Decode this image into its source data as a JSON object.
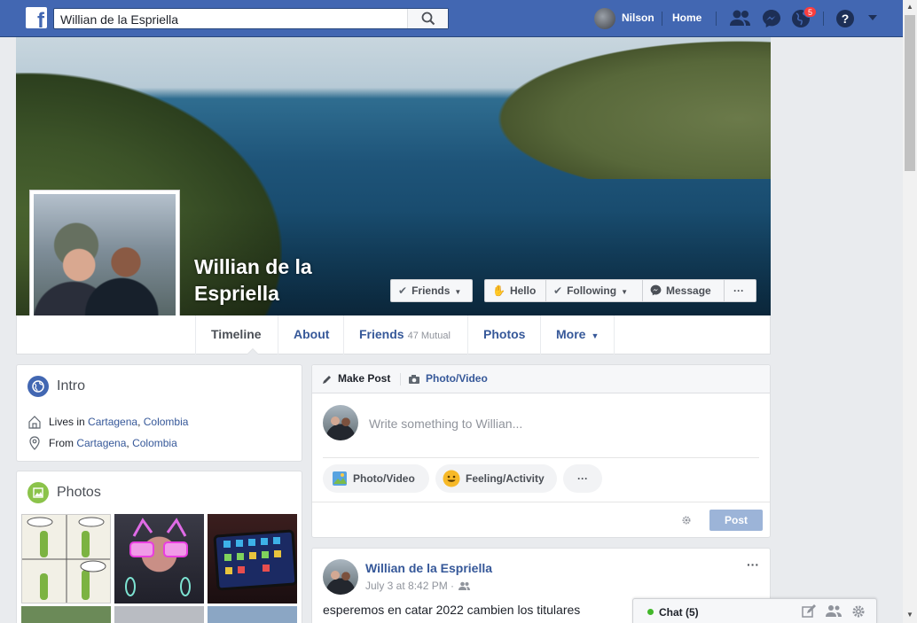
{
  "topbar": {
    "logo": "f",
    "search_value": "Willian de la Espriella",
    "user_name": "Nilson",
    "home_label": "Home",
    "notification_count": "5"
  },
  "profile": {
    "name": "Willian de la Espriella",
    "buttons": {
      "friends": "Friends",
      "hello": "Hello",
      "following": "Following",
      "message": "Message",
      "more": "···"
    }
  },
  "profile_nav": {
    "timeline": "Timeline",
    "about": "About",
    "friends": "Friends",
    "mutual": "47 Mutual",
    "photos": "Photos",
    "more": "More"
  },
  "intro": {
    "title": "Intro",
    "lives_prefix": "Lives in",
    "lives_city": "Cartagena",
    "lives_country": "Colombia",
    "from_prefix": "From",
    "from_city": "Cartagena",
    "from_country": "Colombia"
  },
  "photos": {
    "title": "Photos"
  },
  "composer": {
    "make_post": "Make Post",
    "photo_video_tab": "Photo/Video",
    "placeholder": "Write something to Willian...",
    "photo_video": "Photo/Video",
    "feeling": "Feeling/Activity",
    "more": "···",
    "post": "Post"
  },
  "post": {
    "author": "Willian de la Espriella",
    "timestamp": "July 3 at 8:42 PM ·",
    "text": "esperemos en catar 2022 cambien los titulares",
    "menu": "···"
  },
  "chat": {
    "label": "Chat (5)"
  },
  "colors": {
    "topbar": "#4267b2",
    "link": "#365899",
    "post_button": "#9cb4d8",
    "online": "#42b72a"
  }
}
